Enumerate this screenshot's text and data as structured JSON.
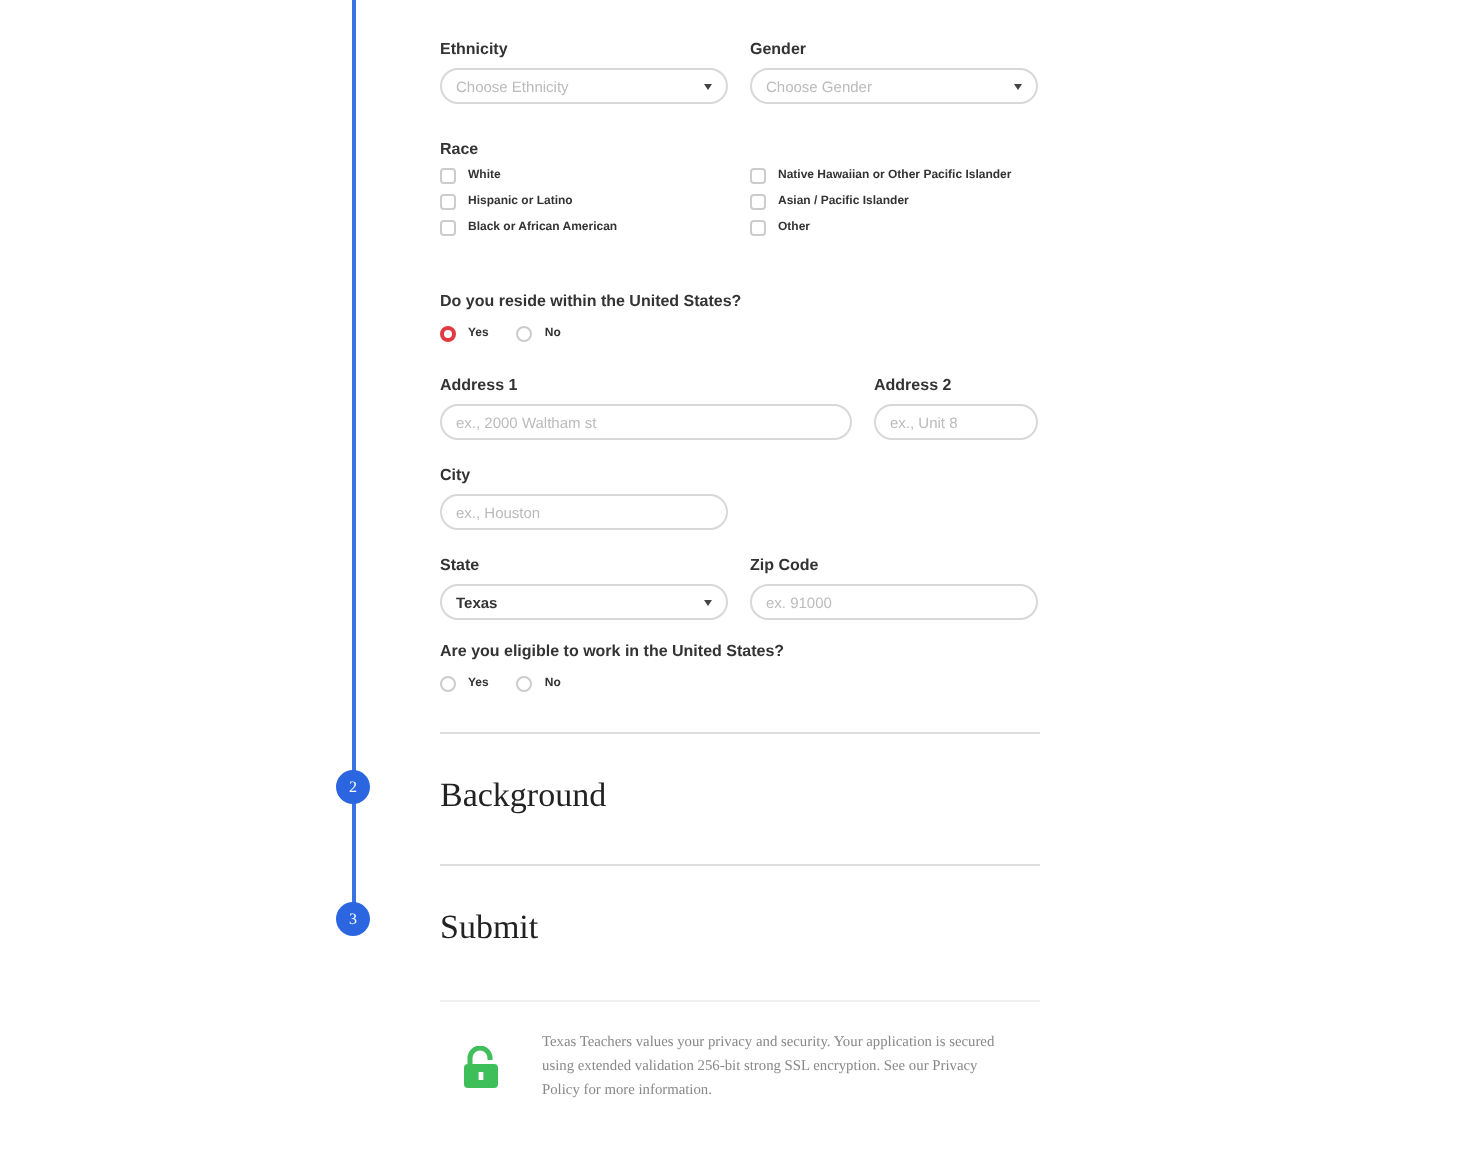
{
  "demographics": {
    "ethnicity": {
      "label": "Ethnicity",
      "placeholder": "Choose Ethnicity"
    },
    "gender": {
      "label": "Gender",
      "placeholder": "Choose Gender"
    },
    "race": {
      "label": "Race",
      "options": [
        {
          "label": "White",
          "checked": false
        },
        {
          "label": "Native Hawaiian or Other Pacific Islander",
          "checked": false
        },
        {
          "label": "Hispanic or Latino",
          "checked": false
        },
        {
          "label": "Asian / Pacific Islander",
          "checked": false
        },
        {
          "label": "Black or African American",
          "checked": false
        },
        {
          "label": "Other",
          "checked": false
        }
      ]
    }
  },
  "residence": {
    "question": "Do you reside within the United States?",
    "options": [
      {
        "label": "Yes",
        "selected": true
      },
      {
        "label": "No",
        "selected": false
      }
    ]
  },
  "address": {
    "address1": {
      "label": "Address 1",
      "placeholder": "ex., 2000 Waltham st"
    },
    "address2": {
      "label": "Address 2",
      "placeholder": "ex., Unit 8"
    },
    "city": {
      "label": "City",
      "placeholder": "ex., Houston"
    },
    "state": {
      "label": "State",
      "value": "Texas"
    },
    "zip": {
      "label": "Zip Code",
      "placeholder": "ex. 91000"
    }
  },
  "eligibility": {
    "question": "Are you eligible to work in the United States?",
    "options": [
      {
        "label": "Yes",
        "selected": false
      },
      {
        "label": "No",
        "selected": false
      }
    ]
  },
  "steps": [
    {
      "number": "2",
      "title": "Background"
    },
    {
      "number": "3",
      "title": "Submit"
    }
  ],
  "privacy": {
    "text": "Texas Teachers values your privacy and security. Your application is secured using extended validation 256-bit strong SSL encryption. See our Privacy Policy for more information."
  }
}
